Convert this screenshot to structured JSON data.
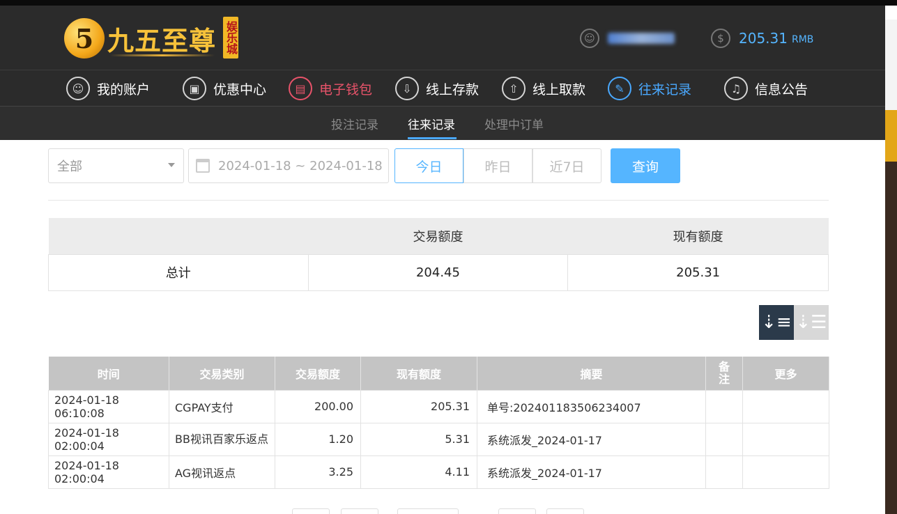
{
  "header": {
    "logo_digit": "5",
    "logo_text": "九五至尊",
    "logo_sub": "娱乐城",
    "user_icon": "user-icon",
    "balance_icon": "dollar-icon",
    "balance_amount": "205.31",
    "balance_unit": "RMB"
  },
  "nav": {
    "items": [
      {
        "label": "我的账户",
        "icon": "user-icon",
        "glyph": "☺"
      },
      {
        "label": "优惠中心",
        "icon": "gift-icon",
        "glyph": "▣"
      },
      {
        "label": "电子钱包",
        "icon": "wallet-icon",
        "glyph": "▤"
      },
      {
        "label": "线上存款",
        "icon": "deposit-icon",
        "glyph": "⇩"
      },
      {
        "label": "线上取款",
        "icon": "withdraw-icon",
        "glyph": "⇧"
      },
      {
        "label": "往来记录",
        "icon": "record-icon",
        "glyph": "✎"
      },
      {
        "label": "信息公告",
        "icon": "bell-icon",
        "glyph": "♫"
      }
    ]
  },
  "subnav": {
    "items": [
      "投注记录",
      "往来记录",
      "处理中订单"
    ]
  },
  "filters": {
    "type_select": "全部",
    "date_range": "2024-01-18 ~ 2024-01-18",
    "today": "今日",
    "yesterday": "昨日",
    "last7": "近7日",
    "query": "查询"
  },
  "summary": {
    "headers": [
      "",
      "交易额度",
      "现有额度"
    ],
    "row_label": "总计",
    "trade_total": "204.45",
    "current_total": "205.31"
  },
  "records": {
    "headers": [
      "时间",
      "交易类别",
      "交易额度",
      "现有额度",
      "摘要",
      "备注",
      "更多"
    ],
    "rows": [
      [
        "2024-01-18 06:10:08",
        "CGPAY支付",
        "200.00",
        "205.31",
        "单号:202401183506234007",
        "",
        ""
      ],
      [
        "2024-01-18 02:00:04",
        "BB视讯百家乐返点",
        "1.20",
        "5.31",
        "系统派发_2024-01-17",
        "",
        ""
      ],
      [
        "2024-01-18 02:00:04",
        "AG视讯返点",
        "3.25",
        "4.11",
        "系统派发_2024-01-17",
        "",
        ""
      ]
    ]
  },
  "colors": {
    "accent_blue": "#55b5ff",
    "active_red": "#e8536a",
    "header_bg": "#2b2b2b"
  }
}
